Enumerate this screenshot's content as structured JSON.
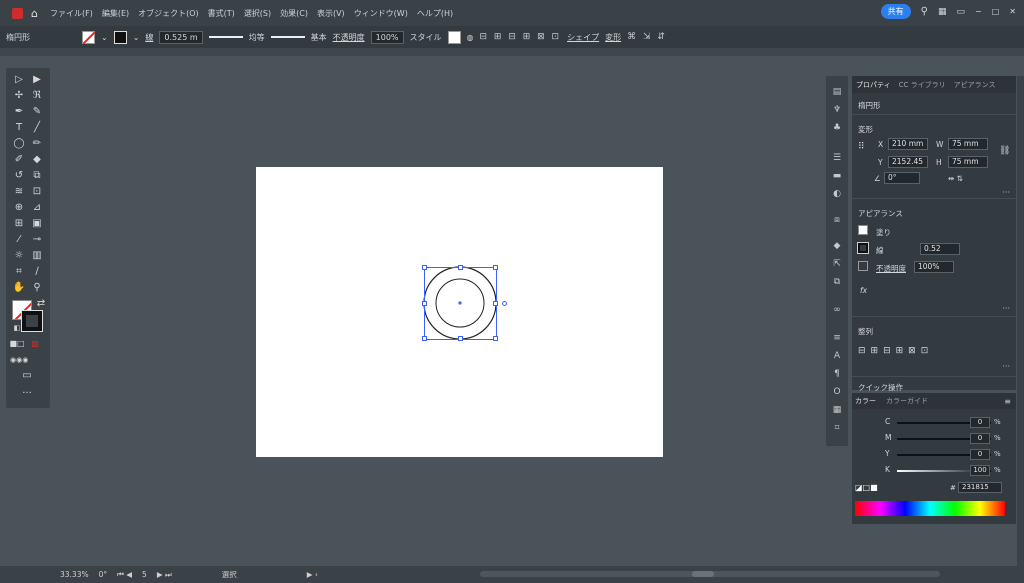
{
  "app": {
    "logo": "Ai"
  },
  "menubar": {
    "home_icon": "home-icon",
    "items": [
      "ファイル(F)",
      "編集(E)",
      "オブジェクト(O)",
      "書式(T)",
      "選択(S)",
      "効果(C)",
      "表示(V)",
      "ウィンドウ(W)",
      "ヘルプ(H)"
    ],
    "share_label": "共有",
    "window_controls": [
      "−",
      "□",
      "✕"
    ]
  },
  "controlbar": {
    "object_type": "楕円形",
    "stroke_label": "線",
    "stroke_value": "0.525 m",
    "profile_label": "均等",
    "brush_label": "基本",
    "opacity_label": "不透明度",
    "opacity_value": "100%",
    "style_label": "スタイル",
    "shape_label": "シェイプ",
    "transform_label": "変形"
  },
  "properties": {
    "tabs": [
      "プロパティ",
      "CC ライブラリ",
      "アピアランス"
    ],
    "selection_type": "楕円形",
    "transform_title": "変形",
    "x_label": "X",
    "x_value": "210 mm",
    "y_label": "Y",
    "y_value": "2152.45",
    "w_label": "W",
    "w_value": "75 mm",
    "h_label": "H",
    "h_value": "75 mm",
    "angle_value": "0°",
    "appearance_title": "アピアランス",
    "fill_label": "塗り",
    "stroke_label": "線",
    "stroke_value": "0.52",
    "opacity_label": "不透明度",
    "opacity_value": "100%",
    "fx_label": "fx",
    "align_title": "整列",
    "quick_actions_title": "クイック操作"
  },
  "color_panel": {
    "tabs": [
      "カラー",
      "カラーガイド"
    ],
    "channels": [
      {
        "label": "C",
        "value": "0"
      },
      {
        "label": "M",
        "value": "0"
      },
      {
        "label": "Y",
        "value": "0"
      },
      {
        "label": "K",
        "value": "100"
      }
    ],
    "pct": "%",
    "hex_value": "231815"
  },
  "statusbar": {
    "zoom": "33.33%",
    "rotation": "0°",
    "artboard_num": "5",
    "tool": "選択"
  },
  "colors": {
    "accent": "#2d7ff0",
    "selection": "#3b62ff",
    "no_fill_red": "#e22222"
  }
}
